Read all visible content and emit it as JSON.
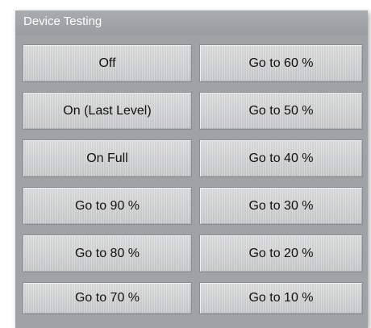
{
  "panel": {
    "title": "Device Testing"
  },
  "buttons": {
    "left": [
      {
        "label": "Off"
      },
      {
        "label": "On (Last Level)"
      },
      {
        "label": "On Full"
      },
      {
        "label": "Go to 90 %"
      },
      {
        "label": "Go to 80 %"
      },
      {
        "label": "Go to 70 %"
      }
    ],
    "right": [
      {
        "label": "Go to 60 %"
      },
      {
        "label": "Go to 50 %"
      },
      {
        "label": "Go to 40 %"
      },
      {
        "label": "Go to 30 %"
      },
      {
        "label": "Go to 20 %"
      },
      {
        "label": "Go to 10 %"
      }
    ]
  },
  "colors": {
    "panel_bg": "#9fa3a6",
    "button_bg": "#d4d5d6",
    "title_text": "#ffffff"
  }
}
